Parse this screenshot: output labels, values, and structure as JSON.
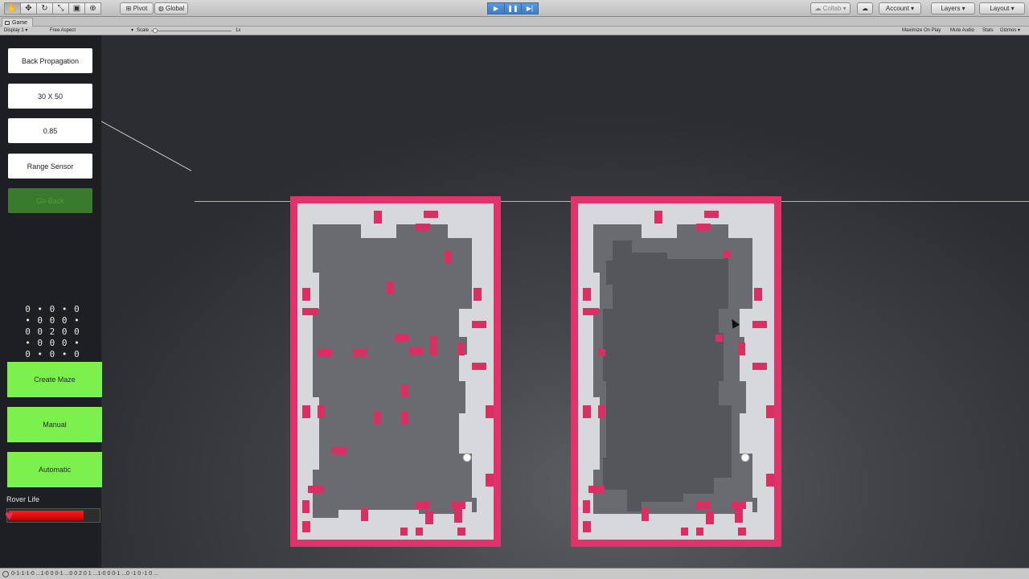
{
  "toolbar": {
    "tools": [
      "hand-icon",
      "move-icon",
      "rotate-icon",
      "scale-icon",
      "rect-icon",
      "transform-icon"
    ],
    "pivot_label": "Pivot",
    "global_label": "Global",
    "collab_label": "Collab",
    "account_label": "Account",
    "layers_label": "Layers",
    "layout_label": "Layout"
  },
  "gameview": {
    "tab_label": "Game",
    "display": "Display 1",
    "aspect": "Free Aspect",
    "scale_label": "Scale",
    "scale_value": "1x",
    "maximize": "Maximize On Play",
    "mute": "Mute Audio",
    "stats": "Stats",
    "gizmos": "Gizmos"
  },
  "panel": {
    "algorithm": "Back Propagation",
    "grid_size": "30 X 50",
    "rate": "0.85",
    "sensor": "Range Sensor",
    "go_back": "Go Back",
    "matrix": [
      "0 • 0 • 0",
      "• 0 0 0 •",
      "0 0 2 0 0",
      "• 0 0 0 •",
      "0 • 0 • 0"
    ],
    "create_maze": "Create Maze",
    "manual": "Manual",
    "automatic": "Automatic",
    "life_label": "Rover Life",
    "life_fraction": 0.85
  },
  "status": {
    "text": "0-1-1-1-0 ...1-0 0 0-1 ...0 0 2 0 1 ...1-0 0 0-1 ...0 -1 0 -1 0 ..."
  },
  "colors": {
    "maze_border": "#e0336c",
    "maze_path": "#d7d8dc",
    "maze_inner": "#6a6b70",
    "maze_explored": "#55565b",
    "obstacle": "#d93064",
    "panel_green": "#7cf04c",
    "life_red": "#e81010"
  }
}
